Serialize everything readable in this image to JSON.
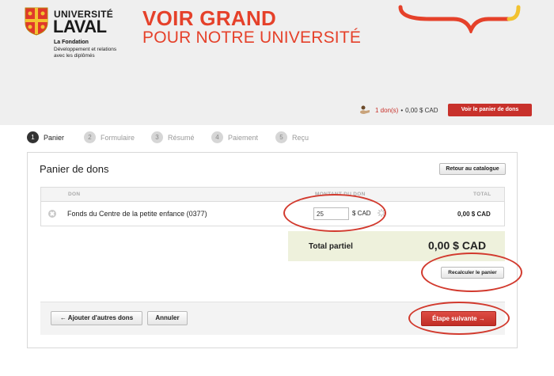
{
  "brand": {
    "university_line1": "UNIVERSITÉ",
    "university_line2": "LAVAL",
    "foundation": "La Fondation",
    "foundation_sub": "Développement et relations avec les diplômés",
    "slogan_line1": "VOIR GRAND",
    "slogan_line2": "POUR NOTRE UNIVERSITÉ",
    "accent_color": "#e5412a"
  },
  "cart_summary": {
    "count": "1 don(s)",
    "separator": "•",
    "amount": "0,00 $ CAD",
    "view_button": "Voir le panier de dons"
  },
  "steps": [
    {
      "num": "1",
      "label": "Panier"
    },
    {
      "num": "2",
      "label": "Formulaire"
    },
    {
      "num": "3",
      "label": "Résumé"
    },
    {
      "num": "4",
      "label": "Paiement"
    },
    {
      "num": "5",
      "label": "Reçu"
    }
  ],
  "panel": {
    "title": "Panier de dons",
    "back_button": "Retour au catalogue",
    "columns": {
      "don": "DON",
      "montant": "MONTANT DU DON",
      "total": "TOTAL"
    },
    "rows": [
      {
        "name": "Fonds du Centre de la petite enfance (0377)",
        "amount_value": "25",
        "currency": "$ CAD",
        "total": "0,00 $ CAD"
      }
    ],
    "total_label": "Total partiel",
    "total_value": "0,00 $ CAD",
    "recalc_button": "Recalculer le panier",
    "add_more_button": "← Ajouter d'autres dons",
    "cancel_button": "Annuler",
    "next_button": "Étape suivante →"
  }
}
